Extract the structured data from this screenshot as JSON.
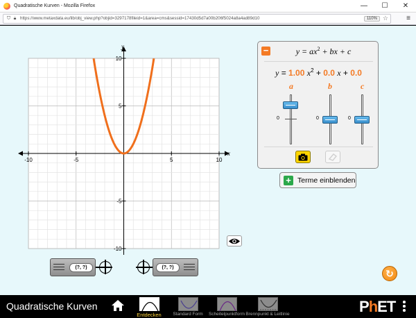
{
  "window": {
    "title": "Quadratische Kurven - Mozilla Firefox",
    "minimize": "—",
    "maximize": "☐",
    "close": "✕"
  },
  "browser": {
    "url": "https://www.metaxdata.eu/lib/obj_view.php?objid=3297178fileid=1&area=cms&sessid=17430d5d7a00b206f5024a8a4ad89d10",
    "zoom": "110%"
  },
  "graph": {
    "x_axis_label": "x",
    "y_axis_label": "y",
    "x_ticks": [
      "-10",
      "-5",
      "5",
      "10"
    ],
    "y_ticks": [
      "10",
      "5",
      "-5",
      "-10"
    ],
    "x_range": [
      -10,
      10
    ],
    "y_range": [
      -10,
      10
    ],
    "curve_color": "#f06f1c",
    "curve": {
      "a": 1,
      "b": 0,
      "c": 0
    }
  },
  "equation_panel": {
    "collapse_label": "−",
    "general_form_y": "y",
    "general_form_eq": " = ax",
    "general_form_sq": "2",
    "general_form_rest": " + bx + c",
    "y": "y",
    "equals": " = ",
    "a_value": "1.00",
    "x2": "x",
    "sq": "2",
    "plus1": " + ",
    "b_value": "0.0",
    "x1": "x",
    "plus2": " + ",
    "c_value": "0.0",
    "coef_a": "a",
    "coef_b": "b",
    "coef_c": "c",
    "slider_zero": "0",
    "accent": "#f47a24",
    "sliders": [
      {
        "name": "a",
        "level": 0.22
      },
      {
        "name": "b",
        "level": 0.5
      },
      {
        "name": "c",
        "level": 0.5
      }
    ]
  },
  "terms_button": {
    "label": "Terme einblenden",
    "icon": "plus-icon"
  },
  "probes": [
    {
      "readout": "(?, ?)"
    },
    {
      "readout": "(?, ?)"
    }
  ],
  "nav": {
    "sim_title": "Quadratische Kurven",
    "screens": [
      {
        "label": "Entdecken",
        "active": true
      },
      {
        "label": "Standard Form",
        "active": false
      },
      {
        "label": "Scheitelpunktform",
        "active": false
      },
      {
        "label": "Brennpunkt & Leitlinie",
        "active": false
      }
    ],
    "brand_p": "P",
    "brand_h": "h",
    "brand_et": "ET"
  }
}
